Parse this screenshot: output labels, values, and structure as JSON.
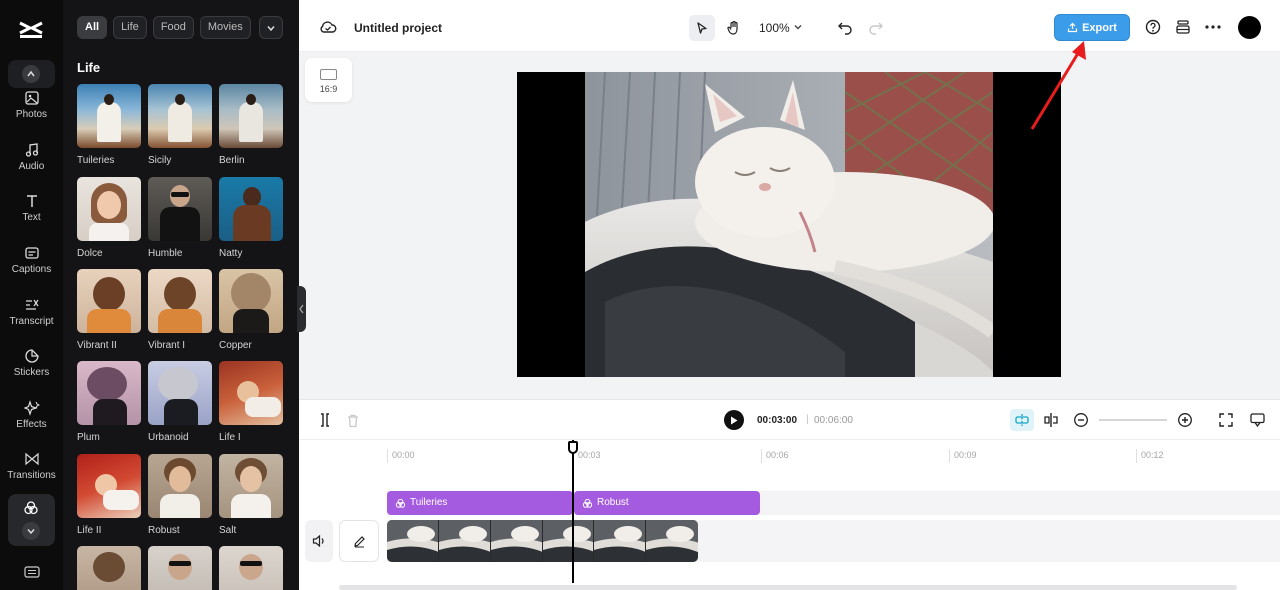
{
  "app": {
    "project_title": "Untitled project",
    "zoom": "100%",
    "export_label": "Export"
  },
  "rail": {
    "items": [
      {
        "label": "Photos",
        "icon": "image-icon"
      },
      {
        "label": "Audio",
        "icon": "music-note-icon"
      },
      {
        "label": "Text",
        "icon": "text-icon"
      },
      {
        "label": "Captions",
        "icon": "captions-icon"
      },
      {
        "label": "Transcript",
        "icon": "transcript-icon"
      },
      {
        "label": "Stickers",
        "icon": "sticker-icon"
      },
      {
        "label": "Effects",
        "icon": "sparkle-icon"
      },
      {
        "label": "Transitions",
        "icon": "transition-icon"
      }
    ]
  },
  "panel": {
    "chips": [
      "All",
      "Life",
      "Food",
      "Movies"
    ],
    "section_title": "Life",
    "filters": [
      "Tuileries",
      "Sicily",
      "Berlin",
      "Dolce",
      "Humble",
      "Natty",
      "Vibrant II",
      "Vibrant I",
      "Copper",
      "Plum",
      "Urbanoid",
      "Life I",
      "Life II",
      "Robust",
      "Salt"
    ]
  },
  "canvas": {
    "ratio_label": "16:9"
  },
  "timeline": {
    "current_time": "00:03:00",
    "separator": "|",
    "total_time": "00:06:00",
    "ruler": [
      "00:00",
      "00:03",
      "00:06",
      "00:09",
      "00:12"
    ],
    "clips": [
      {
        "label": "Tuileries"
      },
      {
        "label": "Robust"
      }
    ]
  },
  "colors": {
    "accent": "#3b9de9",
    "clip": "#a55be0",
    "rail_bg": "#0c0c0d",
    "annotation": "#e81c1c"
  }
}
